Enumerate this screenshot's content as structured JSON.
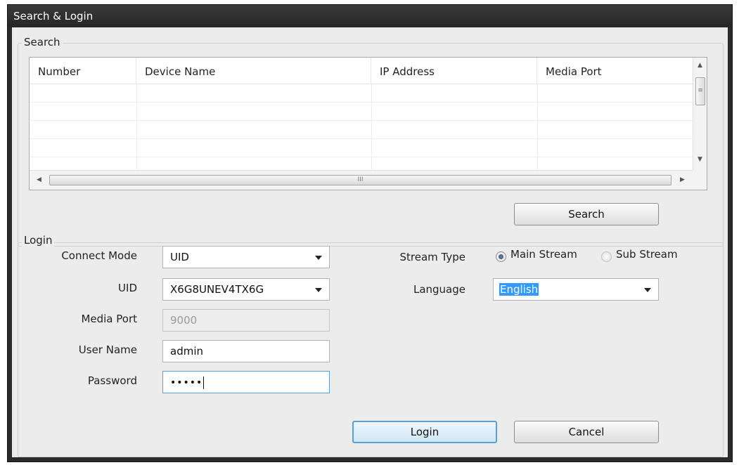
{
  "window": {
    "title": "Search & Login"
  },
  "search": {
    "group_label": "Search",
    "columns": [
      "Number",
      "Device Name",
      "IP Address",
      "Media Port"
    ],
    "rows": [],
    "scroll_marker": "≡",
    "hscroll_marker": "III",
    "search_button": "Search"
  },
  "login": {
    "group_label": "Login",
    "connect_mode": {
      "label": "Connect Mode",
      "value": "UID"
    },
    "uid": {
      "label": "UID",
      "value": "X6G8UNEV4TX6G"
    },
    "media_port": {
      "label": "Media Port",
      "value": "9000"
    },
    "user_name": {
      "label": "User Name",
      "value": "admin"
    },
    "password": {
      "label": "Password",
      "value": "•••••"
    },
    "stream_type": {
      "label": "Stream Type",
      "options": [
        "Main Stream",
        "Sub Stream"
      ],
      "selected": "Main Stream"
    },
    "language": {
      "label": "Language",
      "value": "English"
    },
    "login_button": "Login",
    "cancel_button": "Cancel"
  }
}
